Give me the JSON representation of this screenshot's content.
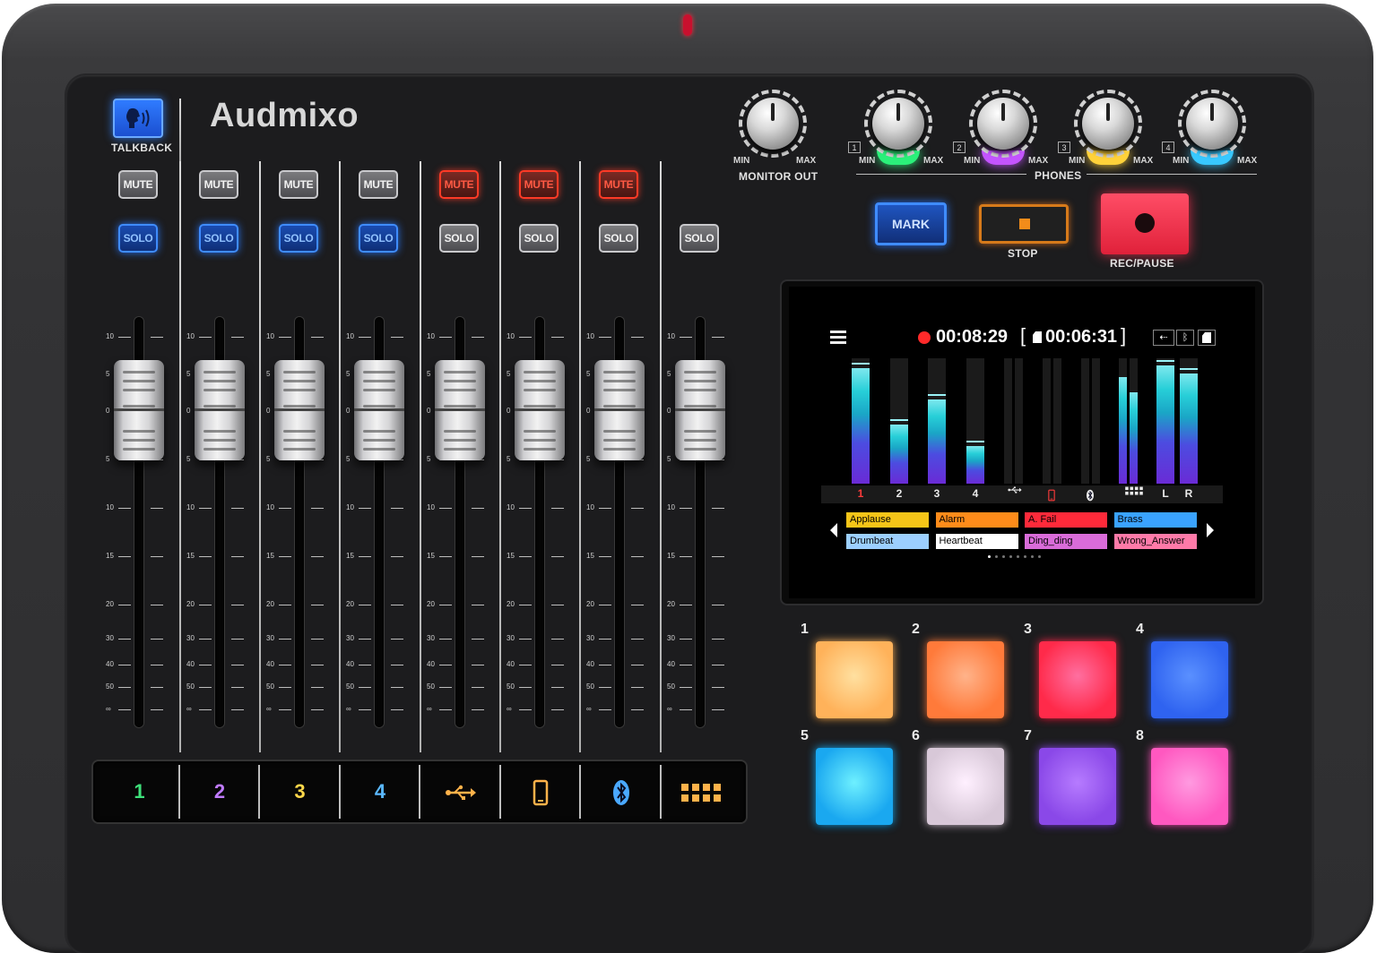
{
  "brand": {
    "name": "Audmixo"
  },
  "talkback": {
    "label": "TALKBACK"
  },
  "channels": [
    {
      "id": "ch1",
      "mute": "MUTE",
      "mute_state": "off",
      "solo": "SOLO",
      "solo_state": "on"
    },
    {
      "id": "ch2",
      "mute": "MUTE",
      "mute_state": "off",
      "solo": "SOLO",
      "solo_state": "on"
    },
    {
      "id": "ch3",
      "mute": "MUTE",
      "mute_state": "off",
      "solo": "SOLO",
      "solo_state": "on"
    },
    {
      "id": "ch4",
      "mute": "MUTE",
      "mute_state": "off",
      "solo": "SOLO",
      "solo_state": "on"
    },
    {
      "id": "usb",
      "mute": "MUTE",
      "mute_state": "on",
      "solo": "SOLO",
      "solo_state": "off"
    },
    {
      "id": "phone",
      "mute": "MUTE",
      "mute_state": "on",
      "solo": "SOLO",
      "solo_state": "off"
    },
    {
      "id": "bluetooth",
      "mute": "MUTE",
      "mute_state": "on",
      "solo": "SOLO",
      "solo_state": "off"
    },
    {
      "id": "pads",
      "solo": "SOLO",
      "solo_state": "off"
    }
  ],
  "fader_scale": [
    "10",
    "5",
    "0",
    "5",
    "10",
    "15",
    "20",
    "30",
    "40",
    "50",
    "∞"
  ],
  "channel_labels": [
    {
      "text": "1",
      "color": "#3ee07a"
    },
    {
      "text": "2",
      "color": "#c07bff"
    },
    {
      "text": "3",
      "color": "#ffd84a"
    },
    {
      "text": "4",
      "color": "#5ab8ff"
    },
    {
      "icon": "usb-icon",
      "color": "#ffb24a"
    },
    {
      "icon": "phone-icon",
      "color": "#ffb24a"
    },
    {
      "icon": "bluetooth-icon",
      "color": "#4aa8ff"
    },
    {
      "icon": "pad-bank-icon",
      "color": "#ffb24a"
    }
  ],
  "monitor": {
    "min": "MIN",
    "max": "MAX",
    "label": "MONITOR OUT"
  },
  "phones": {
    "label": "PHONES",
    "knobs": [
      {
        "num": "1",
        "min": "MIN",
        "max": "MAX",
        "glow": "#2bf07a"
      },
      {
        "num": "2",
        "min": "MIN",
        "max": "MAX",
        "glow": "#c454ff"
      },
      {
        "num": "3",
        "min": "MIN",
        "max": "MAX",
        "glow": "#ffd23a"
      },
      {
        "num": "4",
        "min": "MIN",
        "max": "MAX",
        "glow": "#38c8ff"
      }
    ]
  },
  "transport": {
    "mark": "MARK",
    "stop": "STOP",
    "rec": "REC/PAUSE"
  },
  "screen": {
    "elapsed": "00:08:29",
    "remaining": "00:06:31",
    "meters": [
      {
        "label": "1",
        "label_color": "#ff3b3b",
        "level": 0.92,
        "stereo": false
      },
      {
        "label": "2",
        "label_color": "#eaeaea",
        "level": 0.47,
        "stereo": false
      },
      {
        "label": "3",
        "label_color": "#eaeaea",
        "level": 0.67,
        "stereo": false
      },
      {
        "label": "4",
        "label_color": "#eaeaea",
        "level": 0.3,
        "stereo": false
      },
      {
        "icon": "usb-icon",
        "label_color": "#eaeaea",
        "level": 0.0,
        "stereo": true
      },
      {
        "icon": "phone-icon",
        "label_color": "#ff3b3b",
        "level": 0.0,
        "stereo": true
      },
      {
        "icon": "bluetooth-icon",
        "label_color": "#eaeaea",
        "level": 0.0,
        "stereo": true
      },
      {
        "icon": "pad-bank-icon",
        "label_color": "#eaeaea",
        "level": 0.85,
        "stereo": true,
        "level_r": 0.73
      },
      {
        "label": "L",
        "label_color": "#eaeaea",
        "level": 0.94,
        "stereo": false
      },
      {
        "label": "R",
        "label_color": "#eaeaea",
        "level": 0.88,
        "stereo": false
      }
    ],
    "samples": [
      {
        "name": "Applause",
        "color": "#f5c518"
      },
      {
        "name": "Alarm",
        "color": "#ff8c1a"
      },
      {
        "name": "A. Fail",
        "color": "#ff2a3a"
      },
      {
        "name": "Brass",
        "color": "#3aa3ff"
      },
      {
        "name": "Drumbeat",
        "color": "#9ccfff"
      },
      {
        "name": "Heartbeat",
        "color": "#ffffff"
      },
      {
        "name": "Ding_ding",
        "color": "#d96cd9"
      },
      {
        "name": "Wrong_Answer",
        "color": "#ff7aa8"
      }
    ]
  },
  "pads": [
    {
      "num": "1",
      "color": "#ffb25a",
      "glow": "#ffe0a0"
    },
    {
      "num": "2",
      "color": "#ff7a3a",
      "glow": "#ffb38a"
    },
    {
      "num": "3",
      "color": "#ff2a4a",
      "glow": "#ff6fa0"
    },
    {
      "num": "4",
      "color": "#2f63f0",
      "glow": "#5a90ff"
    },
    {
      "num": "5",
      "color": "#1aa8f0",
      "glow": "#6ef0ff"
    },
    {
      "num": "6",
      "color": "#d8c8d8",
      "glow": "#fff0ff"
    },
    {
      "num": "7",
      "color": "#8a48e8",
      "glow": "#b67bff"
    },
    {
      "num": "8",
      "color": "#ff58c0",
      "glow": "#ff9ae0"
    }
  ]
}
